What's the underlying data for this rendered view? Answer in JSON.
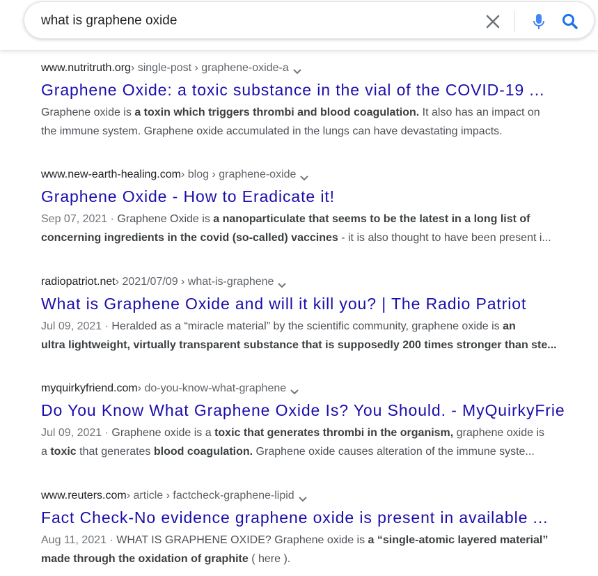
{
  "search": {
    "query": "what is graphene oxide"
  },
  "results": [
    {
      "domain": "www.nutritruth.org",
      "path": " › single-post › graphene-oxide-a",
      "title": "Graphene Oxide: a toxic substance in the vial of the COVID-19 ...",
      "lines": [
        [
          {
            "t": "Graphene oxide is ",
            "b": false
          },
          {
            "t": "a toxin which triggers thrombi and blood coagulation.",
            "b": true
          },
          {
            "t": " It also has an impact on",
            "b": false
          }
        ],
        [
          {
            "t": "the immune system. Graphene oxide accumulated in the lungs can have devastating impacts.",
            "b": false
          }
        ]
      ]
    },
    {
      "domain": "www.new-earth-healing.com",
      "path": " › blog › graphene-oxide",
      "title": "Graphene Oxide - How to Eradicate it!",
      "lines": [
        [
          {
            "t": "Sep 07, 2021 · ",
            "b": false,
            "d": true
          },
          {
            "t": "Graphene Oxide is ",
            "b": false
          },
          {
            "t": "a nanoparticulate that seems to be the latest in a long list of",
            "b": true
          }
        ],
        [
          {
            "t": "concerning ingredients in the covid (so-called) vaccines",
            "b": true
          },
          {
            "t": " - it is also thought to have been present i...",
            "b": false
          }
        ]
      ]
    },
    {
      "domain": "radiopatriot.net",
      "path": " › 2021/07/09 › what-is-graphene",
      "title": "What is Graphene Oxide and will it kill you? | The Radio Patriot",
      "lines": [
        [
          {
            "t": "Jul 09, 2021 · ",
            "b": false,
            "d": true
          },
          {
            "t": "Heralded as a “miracle material” by the scientific community, graphene oxide is ",
            "b": false
          },
          {
            "t": "an",
            "b": true
          }
        ],
        [
          {
            "t": "ultra lightweight, virtually transparent substance that is supposedly 200 times stronger than ste...",
            "b": true
          }
        ]
      ]
    },
    {
      "domain": "myquirkyfriend.com",
      "path": " › do-you-know-what-graphene",
      "title": "Do You Know What Graphene Oxide Is? You Should. - MyQuirkyFrie",
      "lines": [
        [
          {
            "t": "Jul 09, 2021 · ",
            "b": false,
            "d": true
          },
          {
            "t": "Graphene oxide is a ",
            "b": false
          },
          {
            "t": "toxic that generates thrombi in the organism,",
            "b": true
          },
          {
            "t": " graphene oxide is",
            "b": false
          }
        ],
        [
          {
            "t": "a ",
            "b": false
          },
          {
            "t": "toxic",
            "b": true
          },
          {
            "t": " that generates ",
            "b": false
          },
          {
            "t": "blood coagulation.",
            "b": true
          },
          {
            "t": " Graphene oxide causes alteration of the immune syste...",
            "b": false
          }
        ]
      ]
    },
    {
      "domain": "www.reuters.com",
      "path": " › article › factcheck-graphene-lipid",
      "title": "Fact Check-No evidence graphene oxide is present in available ...",
      "lines": [
        [
          {
            "t": "Aug 11, 2021 · ",
            "b": false,
            "d": true
          },
          {
            "t": "WHAT IS GRAPHENE OXIDE? Graphene oxide is ",
            "b": false
          },
          {
            "t": "a “single-atomic layered material”",
            "b": true
          }
        ],
        [
          {
            "t": "made through the oxidation of graphite",
            "b": true
          },
          {
            "t": " ( here ).",
            "b": false
          }
        ]
      ]
    }
  ],
  "icons": {
    "clear": "close-icon",
    "mic": "microphone-icon",
    "search": "search-icon",
    "more": "chevron-down-icon"
  },
  "colors": {
    "link_title": "#1a0dab",
    "snippet": "#4d5156",
    "mic_blue": "#4285f4",
    "search_blue": "#1a73e8"
  }
}
